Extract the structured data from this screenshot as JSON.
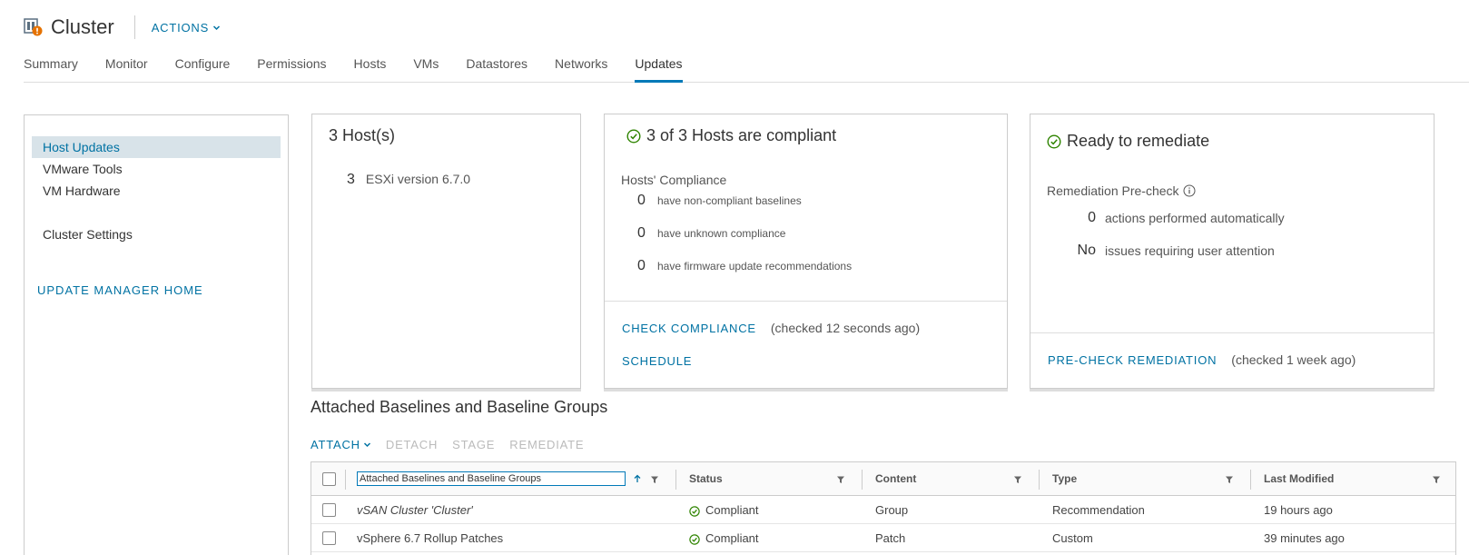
{
  "header": {
    "title": "Cluster",
    "actions_label": "ACTIONS",
    "icon": "cluster-warning-icon"
  },
  "tabs": [
    {
      "label": "Summary"
    },
    {
      "label": "Monitor"
    },
    {
      "label": "Configure"
    },
    {
      "label": "Permissions"
    },
    {
      "label": "Hosts"
    },
    {
      "label": "VMs"
    },
    {
      "label": "Datastores"
    },
    {
      "label": "Networks"
    },
    {
      "label": "Updates",
      "active": true
    }
  ],
  "sidebar": {
    "items": [
      {
        "label": "Host Updates",
        "active": true
      },
      {
        "label": "VMware Tools"
      },
      {
        "label": "VM Hardware"
      },
      {
        "label": "Cluster Settings"
      }
    ],
    "home_link": "UPDATE MANAGER HOME"
  },
  "hosts_card": {
    "title": "3 Host(s)",
    "count": "3",
    "version": "ESXi version 6.7.0"
  },
  "compliance_card": {
    "title": "3 of 3 Hosts are compliant",
    "subtitle": "Hosts' Compliance",
    "rows": [
      {
        "count": "0",
        "label": "have non-compliant baselines"
      },
      {
        "count": "0",
        "label": "have unknown compliance"
      },
      {
        "count": "0",
        "label": "have firmware update recommendations"
      }
    ],
    "check_link": "CHECK COMPLIANCE",
    "checked_text": "(checked 12 seconds ago)",
    "schedule_link": "SCHEDULE"
  },
  "remediate_card": {
    "title": "Ready to remediate",
    "subtitle": "Remediation Pre-check",
    "rows": [
      {
        "count": "0",
        "label": "actions performed automatically"
      },
      {
        "count": "No",
        "label": "issues requiring user attention"
      }
    ],
    "precheck_link": "PRE-CHECK REMEDIATION",
    "checked_text": "(checked 1 week ago)"
  },
  "baselines": {
    "title": "Attached Baselines and Baseline Groups",
    "toolbar": {
      "attach": "ATTACH",
      "detach": "DETACH",
      "stage": "STAGE",
      "remediate": "REMEDIATE"
    },
    "columns": {
      "name": "Attached Baselines and Baseline Groups",
      "status": "Status",
      "content": "Content",
      "type": "Type",
      "modified": "Last Modified"
    },
    "rows": [
      {
        "name": "vSAN Cluster 'Cluster'",
        "status": "Compliant",
        "content": "Group",
        "type": "Recommendation",
        "modified": "19 hours ago"
      },
      {
        "name": "vSphere 6.7 Rollup Patches",
        "status": "Compliant",
        "content": "Patch",
        "type": "Custom",
        "modified": "39 minutes ago"
      }
    ]
  },
  "colors": {
    "link": "#0072a3",
    "success": "#2f8400",
    "active_tab": "#0079b8"
  }
}
